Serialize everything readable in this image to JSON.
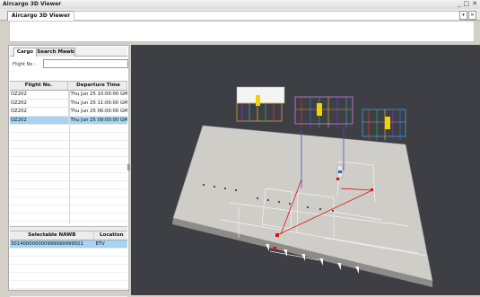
{
  "window": {
    "title": "Aircargo 3D Viewer",
    "controls": [
      "_",
      "□",
      "✕"
    ]
  },
  "document_tab": {
    "label": "Aircargo 3D Viewer"
  },
  "left_panel": {
    "tabs": [
      {
        "label": "Cargo",
        "active": true
      },
      {
        "label": "Search Mawb",
        "active": false
      }
    ],
    "flight_filter": {
      "label": "Flight No :",
      "value": ""
    },
    "flights_table": {
      "columns": [
        "Flight No.",
        "Departure Time"
      ],
      "rows": [
        {
          "flight": "OZ202",
          "time": "Thu Jun 25 10:00:00 GM",
          "selected": false
        },
        {
          "flight": "OZ202",
          "time": "Thu Jun 25 11:00:00 GM",
          "selected": false
        },
        {
          "flight": "OZ202",
          "time": "Thu Jun 25 06:00:00 GM",
          "selected": false
        },
        {
          "flight": "OZ202",
          "time": "Thu Jun 25 09:00:00 GM",
          "selected": true
        }
      ]
    },
    "nawb_table": {
      "columns": [
        "Selectable NAWB",
        "Location"
      ],
      "rows": [
        {
          "nawb": "301400000000999999999501",
          "location": "ETV",
          "selected": true
        }
      ]
    }
  },
  "colors": {
    "selection": "#a5d3f3",
    "viewport_bg": "#3e3f45"
  }
}
